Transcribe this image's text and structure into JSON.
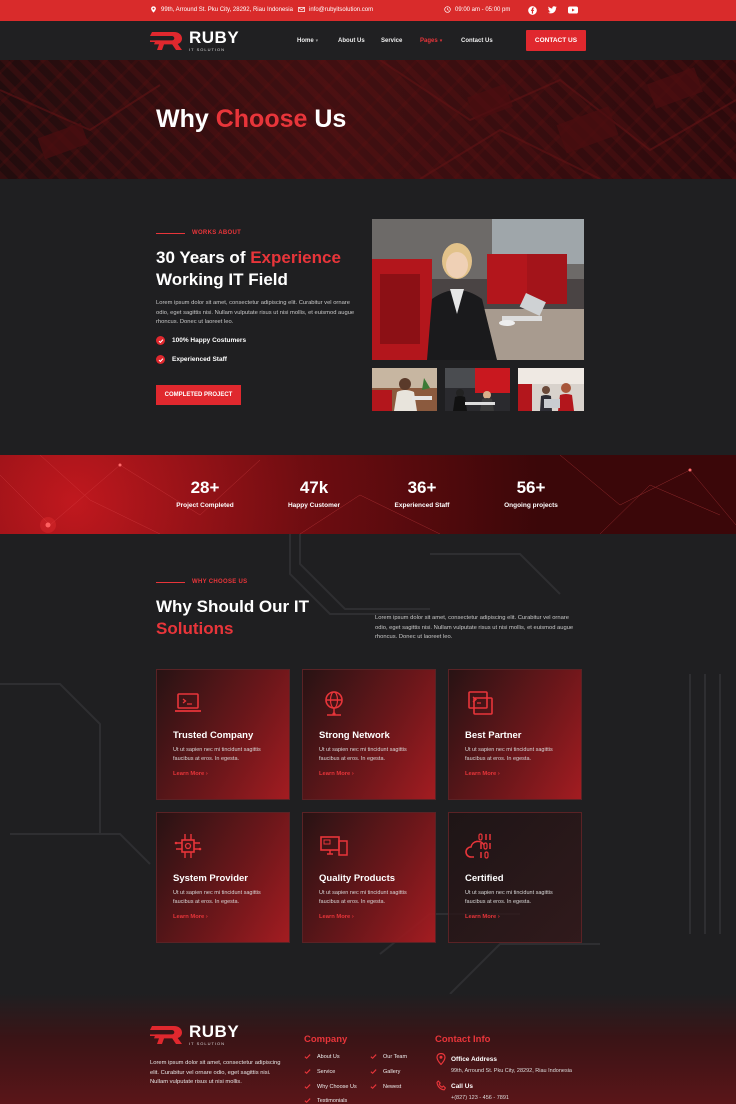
{
  "topbar": {
    "address": "99th, Arround St. Pku City, 28292, Riau Indonesia",
    "email": "info@rubyitsolution.com",
    "hours": "09:00 am - 05:00 pm",
    "social": [
      "facebook-icon",
      "twitter-icon",
      "youtube-icon"
    ]
  },
  "nav": {
    "logo": "RUBY",
    "logo_sub": "IT SOLUTION",
    "items": [
      {
        "label": "Home",
        "dropdown": true
      },
      {
        "label": "About Us",
        "dropdown": false
      },
      {
        "label": "Service",
        "dropdown": false
      },
      {
        "label": "Pages",
        "dropdown": true,
        "active": true
      },
      {
        "label": "Contact Us",
        "dropdown": false
      }
    ],
    "cta": "CONTACT US"
  },
  "hero": {
    "title_a": "Why ",
    "title_b": "Choose",
    "title_c": " Us"
  },
  "about": {
    "tag": "WORKS ABOUT",
    "title_a": "30 Years of ",
    "title_b": "Experience",
    "title_c": "Working IT Field",
    "body": "Lorem ipsum dolor sit amet, consectetur adipiscing elit. Curabitur vel ornare odio, eget sagittis nisi. Nullam vulputate risus ut nisi mollis, et euismod augue rhoncus. Donec ut laoreet leo.",
    "checks": [
      "100% Happy Costumers",
      "Experienced Staff"
    ],
    "button": "COMPLETED PROJECT"
  },
  "stats": [
    {
      "value": "28+",
      "label": "Project Completed"
    },
    {
      "value": "47k",
      "label": "Happy Customer"
    },
    {
      "value": "36+",
      "label": "Experienced Staff"
    },
    {
      "value": "56+",
      "label": "Ongoing projects"
    }
  ],
  "why": {
    "tag": "WHY CHOOSE US",
    "title_a": "Why Should Our IT",
    "title_b": "Solutions",
    "body": "Lorem ipsum dolor sit amet, consectetur adipiscing elit. Curabitur vel ornare odio, eget sagittis nisi. Nullam vulputate risus ut nisi mollis, et euismod augue rhoncus. Donec ut laoreet leo.",
    "cards": [
      {
        "title": "Trusted Company",
        "icon": "laptop-icon",
        "text": "Ut ut sapien nec mi tincidunt sagittis faucibus at eros. In egesta.",
        "link": "Learn More"
      },
      {
        "title": "Strong Network",
        "icon": "globe-network-icon",
        "text": "Ut ut sapien nec mi tincidunt sagittis faucibus at eros. In egesta.",
        "link": "Learn More"
      },
      {
        "title": "Best Partner",
        "icon": "terminal-icon",
        "text": "Ut ut sapien nec mi tincidunt sagittis faucibus at eros. In egesta.",
        "link": "Learn More"
      },
      {
        "title": "System Provider",
        "icon": "chip-icon",
        "text": "Ut ut sapien nec mi tincidunt sagittis faucibus at eros. In egesta.",
        "link": "Learn More"
      },
      {
        "title": "Quality Products",
        "icon": "devices-icon",
        "text": "Ut ut sapien nec mi tincidunt sagittis faucibus at eros. In egesta.",
        "link": "Learn More"
      },
      {
        "title": "Certified",
        "icon": "cloud-binary-icon",
        "text": "Ut ut sapien nec mi tincidunt sagittis faucibus at eros. In egesta.",
        "link": "Learn More"
      }
    ]
  },
  "footer": {
    "about": "Lorem ipsum dolor sit amet, consectetur adipiscing elit. Curabitur vel ornare odio, eget sagittis nisi. Nullam vulputate risus ut nisi mollis.",
    "company_head": "Company",
    "company_col1": [
      "About Us",
      "Service",
      "Why Choose Us",
      "Testimonials"
    ],
    "company_col2": [
      "Our Team",
      "Gallery",
      "Newest"
    ],
    "contact_head": "Contact Info",
    "office_label": "Office Address",
    "office_value": "99th, Arround St. Pku City, 28292, Riau Indonesia",
    "call_label": "Call Us",
    "call_value": "+(827) 123 - 456 - 7891"
  },
  "colors": {
    "accent": "#e0282e",
    "bg": "#1f1f21"
  }
}
